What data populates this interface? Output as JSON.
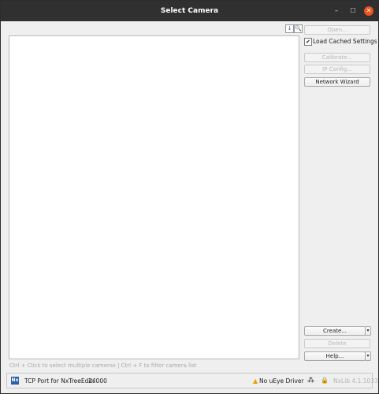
{
  "window": {
    "title": "Select Camera"
  },
  "titlebar": {
    "minimize": "–",
    "maximize": "☐",
    "close": "✕"
  },
  "toolbar": {
    "sort_glyph": "↓",
    "search_glyph": "🔍"
  },
  "sidebar": {
    "open": "Open...",
    "load_cached": "Load Cached Settings",
    "load_cached_checked": true,
    "calibrate": "Calibrate...",
    "ip_config": "IP Config...",
    "network_wizard": "Network Wizard",
    "create": "Create...",
    "delete": "Delete",
    "help": "Help...",
    "dropdown_glyph": "▾"
  },
  "hint": "Ctrl + Click to select multiple cameras | Ctrl + F to filter camera list",
  "status": {
    "app_icon_text": "Nx",
    "tcp_label": "TCP Port for NxTreeEdit:",
    "tcp_value": "24000",
    "warning": "No uEye Driver",
    "version": "NxLib 4.1.1033"
  },
  "colors": {
    "accent_close": "#e95420",
    "titlebar": "#303030",
    "app_icon": "#2b5fa9",
    "warning": "#e8a000"
  }
}
